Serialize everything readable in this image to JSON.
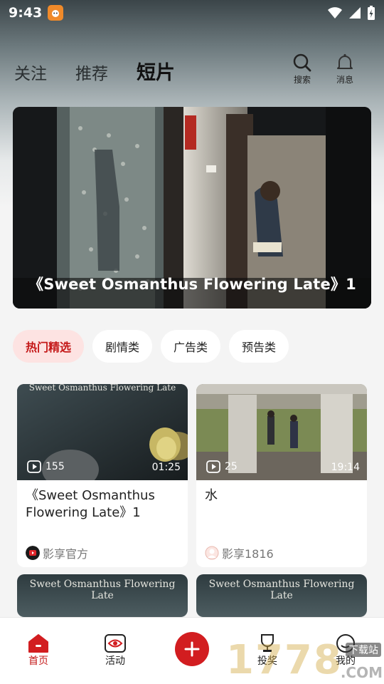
{
  "status_bar": {
    "time": "9:43"
  },
  "top_tabs": [
    {
      "label": "关注"
    },
    {
      "label": "推荐"
    },
    {
      "label": "短片"
    }
  ],
  "top_actions": {
    "search_label": "搜索",
    "messages_label": "消息"
  },
  "banner": {
    "title": "《Sweet Osmanthus Flowering Late》1"
  },
  "category_chips": [
    "热门精选",
    "剧情类",
    "广告类",
    "预告类"
  ],
  "cards": [
    {
      "title": "《Sweet Osmanthus Flowering Late》1",
      "plays": "155",
      "duration": "01:25",
      "author": "影享官方",
      "thumb_text": "Sweet Osmanthus Flowering Late"
    },
    {
      "title": "水",
      "plays": "25",
      "duration": "19:14",
      "author": "影享1816"
    },
    {
      "thumb_text": "Sweet Osmanthus Flowering Late"
    },
    {
      "thumb_text": "Sweet Osmanthus Flowering Late"
    }
  ],
  "bottom_nav": [
    {
      "label": "首页",
      "icon": "home-icon",
      "active": true
    },
    {
      "label": "活动",
      "icon": "activity-eye-icon"
    },
    {
      "label": "",
      "icon": "plus-icon"
    },
    {
      "label": "投奖",
      "icon": "trophy-icon"
    },
    {
      "label": "我的",
      "icon": "profile-icon"
    }
  ],
  "watermark": {
    "text": "1778",
    "tag": "下载站",
    "domain": ".COM"
  },
  "colors": {
    "accent": "#c41818",
    "plus_button": "#d21d20",
    "chip_active_bg": "#fde3e2"
  }
}
